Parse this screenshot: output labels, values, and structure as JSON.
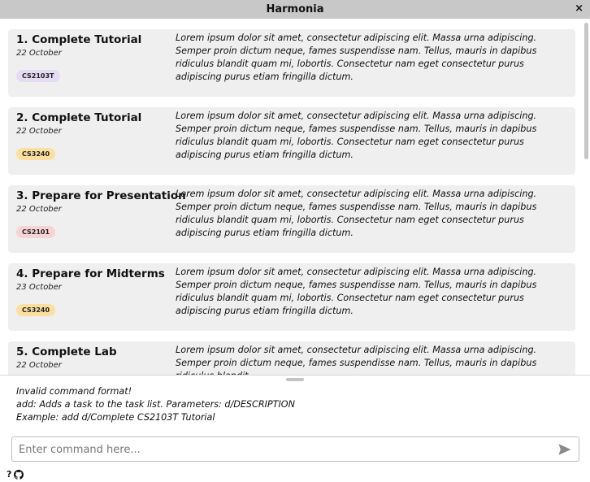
{
  "window": {
    "title": "Harmonia",
    "close_glyph": "×"
  },
  "tasks": [
    {
      "title": "1. Complete Tutorial",
      "date": "22 October",
      "tag": "CS2103T",
      "tag_color": "#e4dbf4",
      "description": "Lorem ipsum dolor sit amet, consectetur adipiscing elit. Massa urna adipiscing. Semper proin dictum neque, fames suspendisse nam. Tellus, mauris in dapibus ridiculus blandit quam mi, lobortis. Consectetur nam eget consectetur purus adipiscing purus etiam fringilla dictum."
    },
    {
      "title": "2. Complete Tutorial",
      "date": "22 October",
      "tag": "CS3240",
      "tag_color": "#fbdf9f",
      "description": "Lorem ipsum dolor sit amet, consectetur adipiscing elit. Massa urna adipiscing. Semper proin dictum neque, fames suspendisse nam. Tellus, mauris in dapibus ridiculus blandit quam mi, lobortis. Consectetur nam eget consectetur purus adipiscing purus etiam fringilla dictum."
    },
    {
      "title": "3. Prepare for Presentation",
      "date": "22 October",
      "tag": "CS2101",
      "tag_color": "#f8d3d3",
      "description": "Lorem ipsum dolor sit amet, consectetur adipiscing elit. Massa urna adipiscing. Semper proin dictum neque, fames suspendisse nam. Tellus, mauris in dapibus ridiculus blandit quam mi, lobortis. Consectetur nam eget consectetur purus adipiscing purus etiam fringilla dictum."
    },
    {
      "title": "4. Prepare for Midterms",
      "date": "23 October",
      "tag": "CS3240",
      "tag_color": "#fbdf9f",
      "description": "Lorem ipsum dolor sit amet, consectetur adipiscing elit. Massa urna adipiscing. Semper proin dictum neque, fames suspendisse nam. Tellus, mauris in dapibus ridiculus blandit quam mi, lobortis. Consectetur nam eget consectetur purus adipiscing purus etiam fringilla dictum."
    },
    {
      "title": "5. Complete Lab",
      "date": "22 October",
      "tag": "",
      "tag_color": "#efefef",
      "description": "Lorem ipsum dolor sit amet, consectetur adipiscing elit. Massa urna adipiscing. Semper proin dictum neque, fames suspendisse nam. Tellus, mauris in dapibus ridiculus blandit"
    }
  ],
  "result": {
    "lines": [
      "Invalid command format!",
      "add: Adds a task to the task list. Parameters: d/DESCRIPTION",
      "Example: add d/Complete CS2103T Tutorial"
    ]
  },
  "command": {
    "placeholder": "Enter command here...",
    "value": ""
  },
  "icons": {
    "close": "close-icon",
    "send": "send-icon",
    "help": "help-icon",
    "github": "github-icon",
    "help_glyph": "?"
  },
  "colors": {
    "titlebar": "#c8c8c8",
    "card_background": "#efefef",
    "send_icon": "#8a8a8a"
  }
}
